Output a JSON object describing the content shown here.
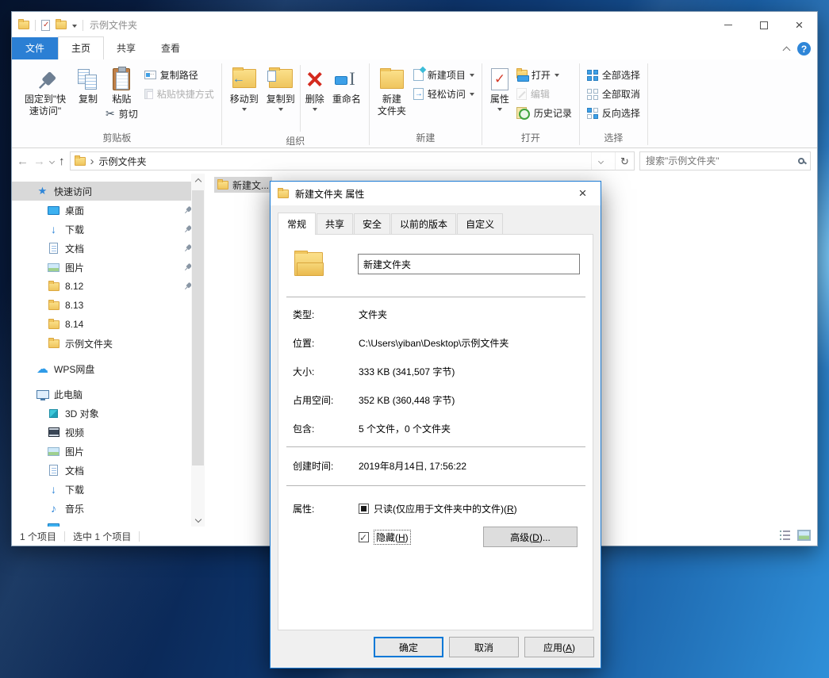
{
  "window": {
    "title": "示例文件夹",
    "tabs": {
      "file": "文件",
      "home": "主页",
      "share": "共享",
      "view": "查看"
    },
    "ribbon": {
      "clipboard": {
        "pin": "固定到\"快速访问\"",
        "copy": "复制",
        "paste": "粘贴",
        "cut": "剪切",
        "copy_path": "复制路径",
        "paste_shortcut": "粘贴快捷方式",
        "label": "剪贴板"
      },
      "organize": {
        "move_to": "移动到",
        "copy_to": "复制到",
        "del": "删除",
        "rename": "重命名",
        "label": "组织"
      },
      "new_group": {
        "new_folder": "新建\n文件夹",
        "new_item": "新建项目",
        "easy_access": "轻松访问",
        "label": "新建"
      },
      "open_group": {
        "properties": "属性",
        "open": "打开",
        "edit": "编辑",
        "history": "历史记录",
        "label": "打开"
      },
      "select_group": {
        "select_all": "全部选择",
        "select_none": "全部取消",
        "invert": "反向选择",
        "label": "选择"
      }
    },
    "address": {
      "crumb": "示例文件夹",
      "search_placeholder": "搜索\"示例文件夹\""
    },
    "sidebar": {
      "items": [
        {
          "label": "快速访问"
        },
        {
          "label": "桌面"
        },
        {
          "label": "下载"
        },
        {
          "label": "文档"
        },
        {
          "label": "图片"
        },
        {
          "label": "8.12"
        },
        {
          "label": "8.13"
        },
        {
          "label": "8.14"
        },
        {
          "label": "示例文件夹"
        },
        {
          "label": "WPS网盘"
        },
        {
          "label": "此电脑"
        },
        {
          "label": "3D 对象"
        },
        {
          "label": "视频"
        },
        {
          "label": "图片"
        },
        {
          "label": "文档"
        },
        {
          "label": "下载"
        },
        {
          "label": "音乐"
        }
      ]
    },
    "file_list": {
      "selected": "新建文..."
    },
    "status": {
      "count": "1 个项目",
      "selected": "选中 1 个项目"
    }
  },
  "dialog": {
    "title": "新建文件夹 属性",
    "tabs": [
      "常规",
      "共享",
      "安全",
      "以前的版本",
      "自定义"
    ],
    "name_value": "新建文件夹",
    "rows": [
      {
        "label": "类型:",
        "value": "文件夹"
      },
      {
        "label": "位置:",
        "value": "C:\\Users\\yiban\\Desktop\\示例文件夹"
      },
      {
        "label": "大小:",
        "value": "333 KB (341,507 字节)"
      },
      {
        "label": "占用空间:",
        "value": "352 KB (360,448 字节)"
      },
      {
        "label": "包含:",
        "value": "5 个文件，0 个文件夹"
      }
    ],
    "created": {
      "label": "创建时间:",
      "value": "2019年8月14日, 17:56:22"
    },
    "attributes_label": "属性:",
    "readonly": {
      "pre": "只读(仅应用于文件夹中的文件)(",
      "key": "R",
      "post": ")"
    },
    "hidden": {
      "pre": "隐藏(",
      "key": "H",
      "post": ")"
    },
    "advanced": {
      "pre": "高级(",
      "key": "D",
      "post": ")..."
    },
    "buttons": {
      "ok": "确定",
      "cancel": "取消",
      "apply_pre": "应用(",
      "apply_key": "A",
      "apply_post": ")"
    }
  },
  "icons": {
    "quick-access": "blue star",
    "folder": "yellow folder",
    "search": "magnifier",
    "refresh": "circular arrow ↻",
    "cut": "scissors ✂",
    "delete": "red ×",
    "download": "blue ↓",
    "cloud": "cloud ☁",
    "music": "note ♪",
    "pin": "gray pushpin",
    "help": "blue ? circle",
    "close": "×"
  }
}
